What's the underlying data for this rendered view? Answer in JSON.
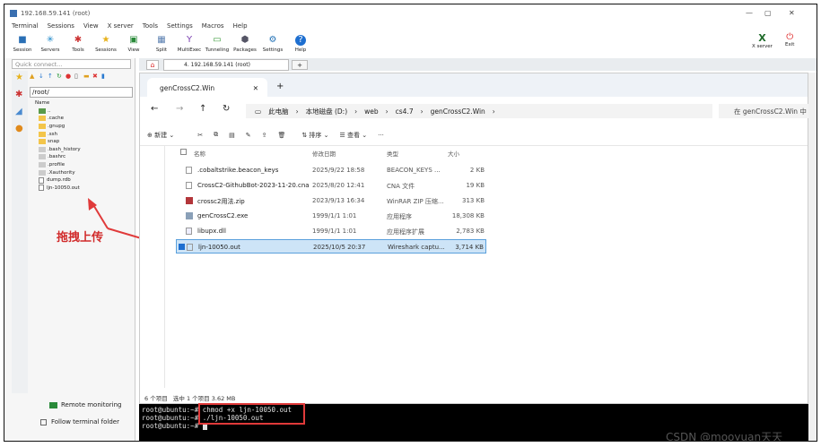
{
  "window_title": "192.168.59.141 (root)",
  "menu": [
    "Terminal",
    "Sessions",
    "View",
    "X server",
    "Tools",
    "Settings",
    "Macros",
    "Help"
  ],
  "toolbar": [
    "Session",
    "Servers",
    "Tools",
    "Sessions",
    "View",
    "Split",
    "MultiExec",
    "Tunneling",
    "Packages",
    "Settings",
    "Help"
  ],
  "toolbar_right": [
    "X server",
    "Exit"
  ],
  "quick_connect": "Quick connect...",
  "session_tab": "4. 192.168.59.141 (root)",
  "path": "/root/",
  "tree_header": "Name",
  "tree": [
    "..",
    ".cache",
    ".gnupg",
    ".ssh",
    "snap",
    ".bash_history",
    ".bashrc",
    ".profile",
    ".Xauthority",
    "dump.rdb",
    "ljn-10050.out"
  ],
  "remote_monitoring": "Remote monitoring",
  "follow_folder": "Follow terminal folder",
  "annotation": "拖拽上传",
  "explorer": {
    "tab_title": "genCrossC2.Win",
    "breadcrumbs": [
      "此电脑",
      "本地磁盘 (D:)",
      "web",
      "cs4.7",
      "genCrossC2.Win"
    ],
    "search": "在 genCrossC2.Win 中",
    "cmd": {
      "new": "新建",
      "sort": "排序",
      "view": "查看"
    },
    "headers": {
      "name": "名称",
      "date": "修改日期",
      "type": "类型",
      "size": "大小"
    },
    "files": [
      {
        "name": ".cobaltstrike.beacon_keys",
        "date": "2025/9/22 18:58",
        "type": "BEACON_KEYS ...",
        "size": "2 KB"
      },
      {
        "name": "CrossC2-GithubBot-2023-11-20.cna",
        "date": "2025/8/20 12:41",
        "type": "CNA 文件",
        "size": "19 KB"
      },
      {
        "name": "crossc2用法.zip",
        "date": "2023/9/13 16:34",
        "type": "WinRAR ZIP 压缩...",
        "size": "313 KB"
      },
      {
        "name": "genCrossC2.exe",
        "date": "1999/1/1 1:01",
        "type": "应用程序",
        "size": "18,308 KB"
      },
      {
        "name": "libupx.dll",
        "date": "1999/1/1 1:01",
        "type": "应用程序扩展",
        "size": "2,783 KB"
      },
      {
        "name": "ljn-10050.out",
        "date": "2025/10/5 20:37",
        "type": "Wireshark captu...",
        "size": "3,714 KB"
      }
    ],
    "status_count": "6 个项目",
    "status_selected": "选中 1 个项目  3.62 MB"
  },
  "terminal": [
    "root@ubuntu:~# chmod +x ljn-10050.out",
    "root@ubuntu:~# ./ljn-10050.out",
    "root@ubuntu:~# "
  ],
  "watermark": "CSDN @mooyuan天天"
}
